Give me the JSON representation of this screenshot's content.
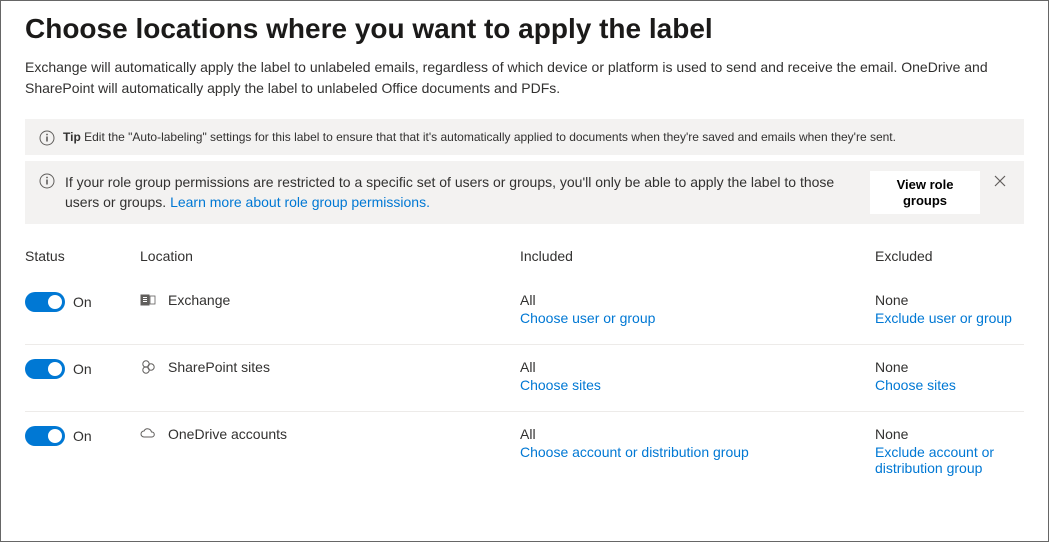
{
  "title": "Choose locations where you want to apply the label",
  "description": "Exchange will automatically apply the label to unlabeled emails, regardless of which device or platform is used to send and receive the email. OneDrive and SharePoint will automatically apply the label to unlabeled Office documents and PDFs.",
  "tip_bar": {
    "prefix": "Tip",
    "text": "Edit the \"Auto-labeling\" settings for this label to ensure that that it's automatically applied to documents when they're saved and emails when they're sent."
  },
  "role_bar": {
    "text": "If your role group permissions are restricted to a specific set of users or groups, you'll only be able to apply the label to those users or groups.  ",
    "link": "Learn more about role group permissions.",
    "button_line1": "View role",
    "button_line2": "groups"
  },
  "table": {
    "headers": {
      "status": "Status",
      "location": "Location",
      "included": "Included",
      "excluded": "Excluded"
    },
    "rows": [
      {
        "status": "On",
        "location": "Exchange",
        "included_value": "All",
        "included_link": "Choose user or group",
        "excluded_value": "None",
        "excluded_link": "Exclude user or group"
      },
      {
        "status": "On",
        "location": "SharePoint sites",
        "included_value": "All",
        "included_link": "Choose sites",
        "excluded_value": "None",
        "excluded_link": "Choose sites"
      },
      {
        "status": "On",
        "location": "OneDrive accounts",
        "included_value": "All",
        "included_link": "Choose account or distribution group",
        "excluded_value": "None",
        "excluded_link": "Exclude account or distribution group"
      }
    ]
  }
}
